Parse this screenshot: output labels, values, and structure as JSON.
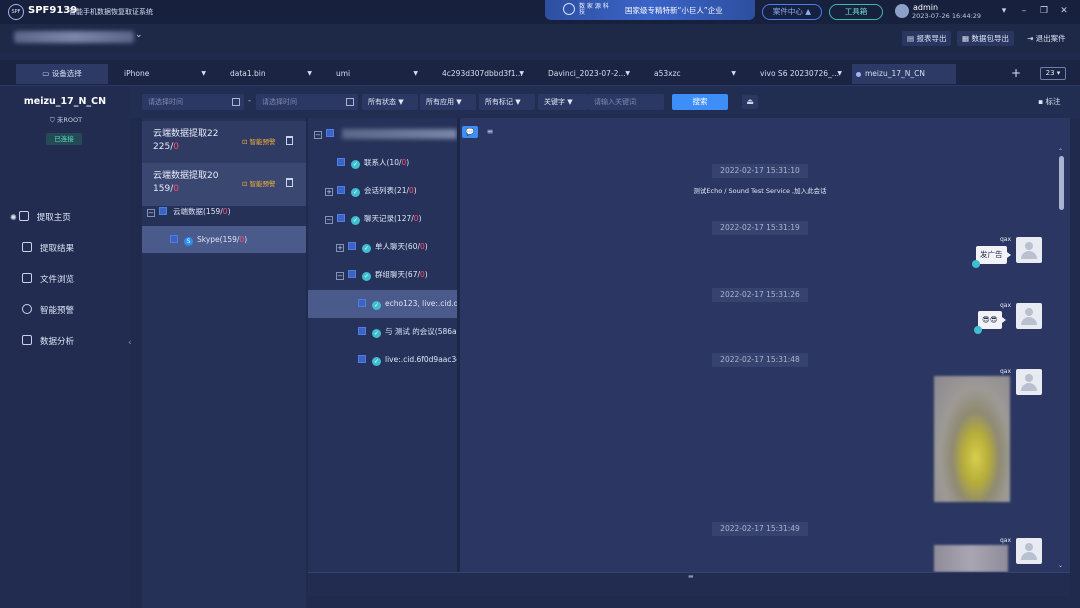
{
  "titlebar": {
    "logo": "SPF",
    "app_name": "SPF9139",
    "subtitle": "智能手机数据恢复取证系统",
    "banner_company": "数 家 源 科 技",
    "banner_text": "国家级专精特新“小巨人”企业",
    "case_center": "案件中心 ▲",
    "toolbox": "工具箱",
    "user": "admin",
    "datetime": "2023-07-26 16:44:29",
    "win_icons": [
      "chevron-down-icon",
      "minimize-icon",
      "restore-icon",
      "close-icon"
    ]
  },
  "toolbar": {
    "report_export": "报表导出",
    "package_export": "数据包导出",
    "exit_case": "退出案件"
  },
  "tabs": [
    {
      "label": "设备选择"
    },
    {
      "label": "iPhone"
    },
    {
      "label": "data1.bin"
    },
    {
      "label": "umi"
    },
    {
      "label": "4c293d307dbbd3f1..."
    },
    {
      "label": "Davinci_2023-07-2..."
    },
    {
      "label": "a53xzc"
    },
    {
      "label": "vivo S6 20230726_..."
    },
    {
      "label": "meizu_17_N_CN"
    }
  ],
  "tab_add": "+",
  "tab_zoom": "23 ▾",
  "device": {
    "name": "meizu_17_N_CN",
    "root": "未ROOT",
    "status": "已连接"
  },
  "nav": [
    {
      "label": "提取主页",
      "icon": "home-icon"
    },
    {
      "label": "提取结果",
      "icon": "result-icon"
    },
    {
      "label": "文件浏览",
      "icon": "folder-icon"
    },
    {
      "label": "智能预警",
      "icon": "shield-icon"
    },
    {
      "label": "数据分析",
      "icon": "chart-icon"
    }
  ],
  "filters": {
    "start_placeholder": "请选择时间",
    "end_placeholder": "请选择时间",
    "dash": "-",
    "status": "所有状态 ▼",
    "apps": "所有应用 ▼",
    "tags": "所有标记 ▼",
    "keyword": "关键字 ▼",
    "keyword_placeholder": "请输入关键词",
    "search": "搜索",
    "mark": "标注"
  },
  "cards": [
    {
      "title": "云端数据提取22",
      "count": "225",
      "red": "0",
      "warn": "智能预警"
    },
    {
      "title": "云端数据提取20",
      "count": "159",
      "red": "0",
      "warn": "智能预警"
    }
  ],
  "tree1": {
    "root": "云端数据(159/",
    "root_red": "0",
    "root_end": ")",
    "skype": "Skype(159/",
    "skype_red": "0",
    "skype_end": ")"
  },
  "tree2": [
    {
      "label": "联系人(10/",
      "red": "0",
      "end": ")"
    },
    {
      "label": "会话列表(21/",
      "red": "0",
      "end": ")"
    },
    {
      "label": "聊天记录(127/",
      "red": "0",
      "end": ")"
    },
    {
      "label": "单人聊天(60/",
      "red": "0",
      "end": ")"
    },
    {
      "label": "群组聊天(67/",
      "red": "0",
      "end": ")"
    },
    {
      "label": "echo123, live:.cid.d"
    },
    {
      "label": "与 测试 的会议(586a"
    },
    {
      "label": "live:.cid.6f0d9aac3e"
    }
  ],
  "chat": {
    "timestamps": [
      "2022-02-17 15:31:10",
      "2022-02-17 15:31:19",
      "2022-02-17 15:31:26",
      "2022-02-17 15:31:48",
      "2022-02-17 15:31:49"
    ],
    "system": "测试Echo / Sound Test Service ,加入此会话",
    "sender": "qax",
    "msg1": "发广告",
    "msg2": "😎😎"
  }
}
